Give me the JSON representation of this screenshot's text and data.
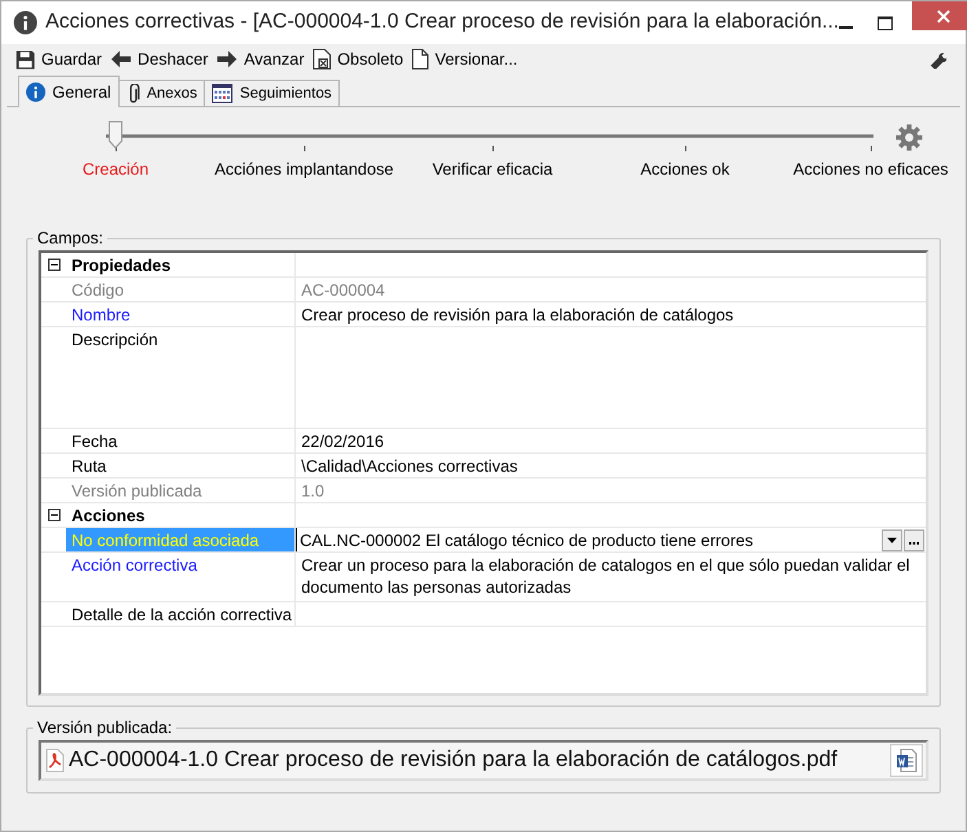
{
  "window": {
    "title": "Acciones correctivas - [AC-000004-1.0 Crear proceso de revisión para la elaboración..."
  },
  "toolbar": [
    {
      "label": "Guardar",
      "kind": "save"
    },
    {
      "label": "Deshacer",
      "kind": "back"
    },
    {
      "label": "Avanzar",
      "kind": "forward"
    },
    {
      "label": "Obsoleto",
      "kind": "obsolete"
    },
    {
      "label": "Versionar...",
      "kind": "page"
    }
  ],
  "tabs": [
    {
      "label": "General",
      "kind": "info",
      "selected": true
    },
    {
      "label": "Anexos",
      "kind": "clip",
      "selected": false
    },
    {
      "label": "Seguimientos",
      "kind": "calendar",
      "selected": false
    }
  ],
  "workflow": [
    {
      "label": "Creación",
      "selected": true
    },
    {
      "label": "Acciónes implantandose",
      "selected": false
    },
    {
      "label": "Verificar eficacia",
      "selected": false
    },
    {
      "label": "Acciones ok",
      "selected": false
    },
    {
      "label": "Acciones no eficaces",
      "selected": false
    }
  ],
  "fields": {
    "legend": "Campos:",
    "categories": [
      {
        "label": "Propiedades",
        "expanded": true,
        "rows": [
          {
            "label": "Código",
            "value": "AC-000004",
            "kind": "readonly",
            "selected": false
          },
          {
            "label": "Nombre",
            "value": "Crear proceso de revisión para la elaboración de catálogos",
            "kind": "required",
            "selected": false
          },
          {
            "label": "Descripción",
            "kind": "memo",
            "selected": false
          },
          {
            "label": "Fecha",
            "value": "22/02/2016",
            "kind": "optional",
            "selected": false
          },
          {
            "label": "Ruta",
            "value": "\\Calidad\\Acciones correctivas",
            "kind": "optional",
            "selected": false
          },
          {
            "label": "Versión publicada",
            "value": "1.0",
            "kind": "readonly",
            "selected": false
          }
        ]
      },
      {
        "label": "Acciones",
        "expanded": true,
        "rows": [
          {
            "label": "No conformidad asociada",
            "value": "CAL.NC-000002 El catálogo técnico de producto tiene errores",
            "kind": "required",
            "selected": true
          },
          {
            "label": "Acción correctiva",
            "value": "Crear un proceso para la elaboración de catalogos en el que sólo puedan validar el documento las personas autorizadas",
            "kind": "required",
            "selected": false
          },
          {
            "label": "Detalle de la acción correctiva",
            "kind": "optional",
            "selected": false
          }
        ]
      }
    ]
  },
  "published": {
    "legend": "Versión publicada:",
    "file": "AC-000004-1.0 Crear proceso de revisión para la elaboración de catálogos.pdf"
  }
}
